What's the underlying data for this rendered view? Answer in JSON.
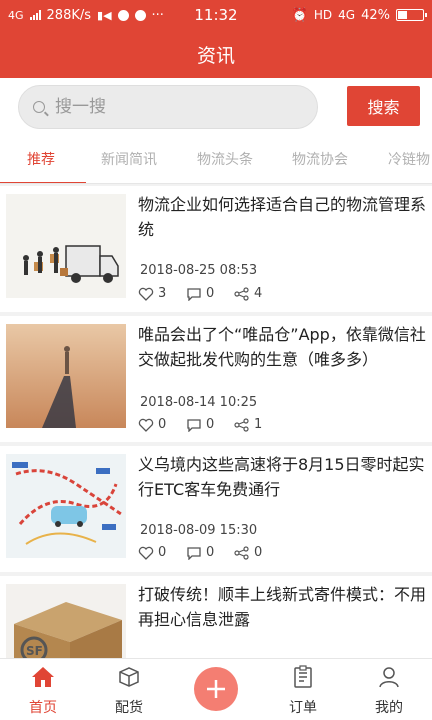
{
  "status_bar": {
    "network": "4G",
    "speed": "288K/s",
    "time": "11:32",
    "hd": "HD",
    "network_right": "4G",
    "battery": "42%",
    "battery_level": 0.42
  },
  "nav": {
    "title": "资讯"
  },
  "search": {
    "placeholder": "搜一搜",
    "button_label": "搜索"
  },
  "tabs": [
    {
      "label": "推荐",
      "active": true
    },
    {
      "label": "新闻简讯",
      "active": false
    },
    {
      "label": "物流头条",
      "active": false
    },
    {
      "label": "物流协会",
      "active": false
    },
    {
      "label": "冷链物",
      "active": false
    }
  ],
  "news": [
    {
      "title": "物流企业如何选择适合自己的物流管理系统",
      "date": "2018-08-25 08:53",
      "likes": "3",
      "comments": "0",
      "shares": "4",
      "thumb": "delivery-truck"
    },
    {
      "title": "唯品会出了个“唯品仓”App，依靠微信社交做起批发代购的生意（唯多多）",
      "date": "2018-08-14 10:25",
      "likes": "0",
      "comments": "0",
      "shares": "1",
      "thumb": "person-in-desert"
    },
    {
      "title": "义乌境内这些高速将于8月15日零时起实行ETC客车免费通行",
      "date": "2018-08-09 15:30",
      "likes": "0",
      "comments": "0",
      "shares": "0",
      "thumb": "highway-map"
    },
    {
      "title": "打破传统！顺丰上线新式寄件模式：不用再担心信息泄露",
      "date": "",
      "likes": "",
      "comments": "",
      "shares": "",
      "thumb": "sf-box"
    }
  ],
  "bottom_nav": [
    {
      "label": "首页",
      "icon": "home-icon",
      "active": true
    },
    {
      "label": "配货",
      "icon": "box-icon",
      "active": false
    },
    {
      "label": "",
      "icon": "plus-icon",
      "active": false
    },
    {
      "label": "订单",
      "icon": "order-icon",
      "active": false
    },
    {
      "label": "我的",
      "icon": "user-icon",
      "active": false
    }
  ],
  "colors": {
    "accent": "#e04535",
    "plus": "#f47e72"
  }
}
